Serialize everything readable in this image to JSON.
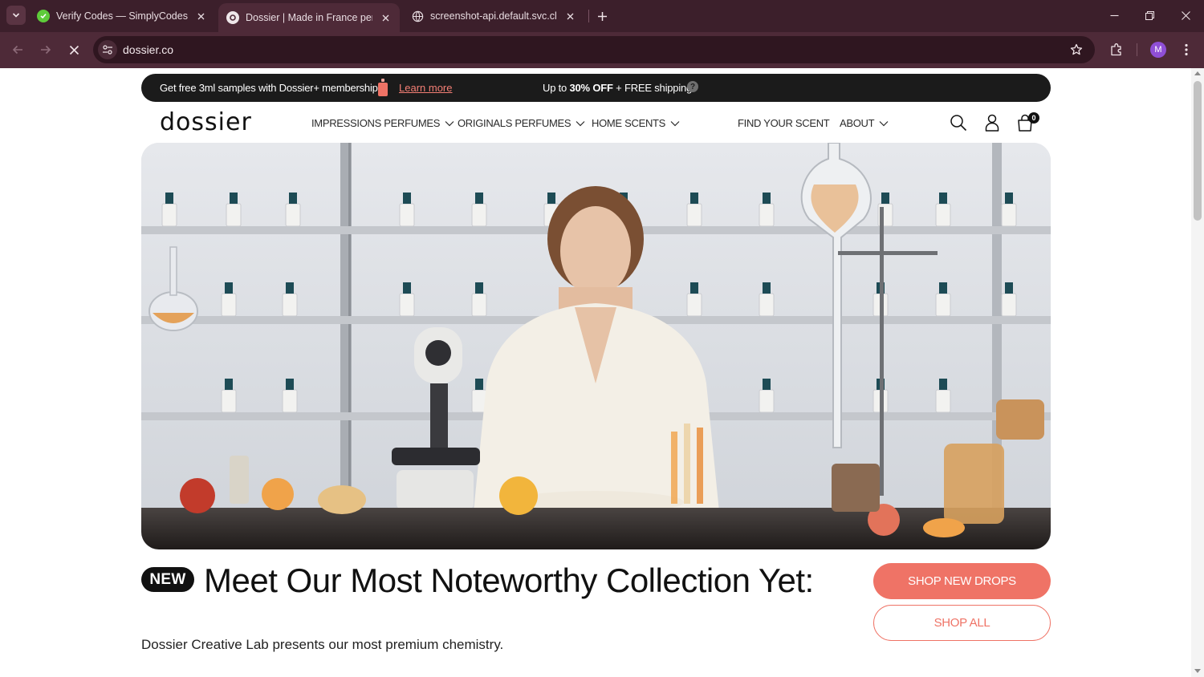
{
  "browser": {
    "tabs": [
      {
        "title": "Verify Codes — SimplyCodes",
        "active": false
      },
      {
        "title": "Dossier | Made in France perfume",
        "active": true
      },
      {
        "title": "screenshot-api.default.svc.cluster.local",
        "active": false
      }
    ],
    "address": "dossier.co",
    "profile_initial": "M",
    "colors": {
      "tabstrip": "#3c1f2b",
      "toolbar": "#4e2a38"
    }
  },
  "promo": {
    "left_text": "Get free 3ml samples with Dossier+ membership",
    "link": "Learn more",
    "right_prefix": "Up to",
    "right_bold": "30% OFF",
    "right_suffix": "+ FREE shipping",
    "help": "?"
  },
  "header": {
    "logo": "dossier",
    "nav": [
      {
        "label": "IMPRESSIONS PERFUMES",
        "dropdown": true
      },
      {
        "label": "ORIGINALS PERFUMES",
        "dropdown": true
      },
      {
        "label": "HOME SCENTS",
        "dropdown": true
      },
      {
        "label": "FIND YOUR SCENT",
        "dropdown": false
      },
      {
        "label": "ABOUT",
        "dropdown": true
      }
    ],
    "cart_count": "0"
  },
  "main": {
    "badge": "NEW",
    "headline": "Meet Our Most Noteworthy Collection Yet:",
    "subtext": "Dossier Creative Lab presents our most premium chemistry.",
    "primary_cta": "SHOP NEW DROPS",
    "secondary_cta": "SHOP ALL"
  },
  "colors": {
    "accent": "#ef7366",
    "dark": "#111111",
    "promo_bg": "#1b1b1b"
  }
}
